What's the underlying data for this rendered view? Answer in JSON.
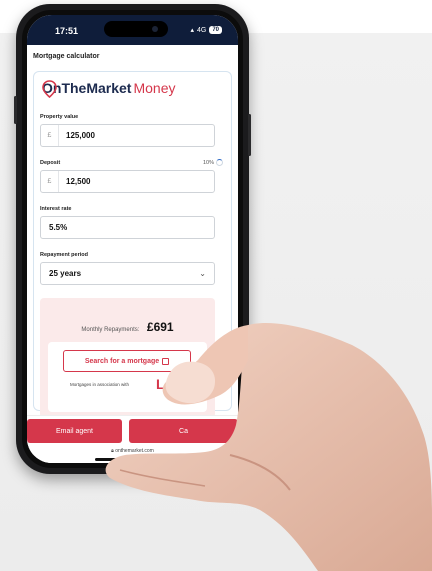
{
  "status": {
    "time": "17:51",
    "network": "4G",
    "battery": "70"
  },
  "page_title": "Mortgage calculator",
  "logo": {
    "part1": "OnTheMarket",
    "part2": "Money"
  },
  "property": {
    "label": "Property value",
    "currency": "£",
    "value": "125,000"
  },
  "deposit": {
    "label": "Deposit",
    "percent": "10%",
    "currency": "£",
    "value": "12,500"
  },
  "interest": {
    "label": "Interest rate",
    "value": "5.5%"
  },
  "period": {
    "label": "Repayment period",
    "value": "25 years"
  },
  "repayments": {
    "label": "Monthly Repayments:",
    "value": "£691"
  },
  "search_button": "Search for a mortgage",
  "association": "Mortgages in association with",
  "association_logo": "L",
  "email_button": "Email agent",
  "call_button": "Ca",
  "url": "onthemarket.com",
  "colors": {
    "brand_red": "#d5374b",
    "navy": "#1d2b4f",
    "statusbar": "#0f1d3a"
  }
}
